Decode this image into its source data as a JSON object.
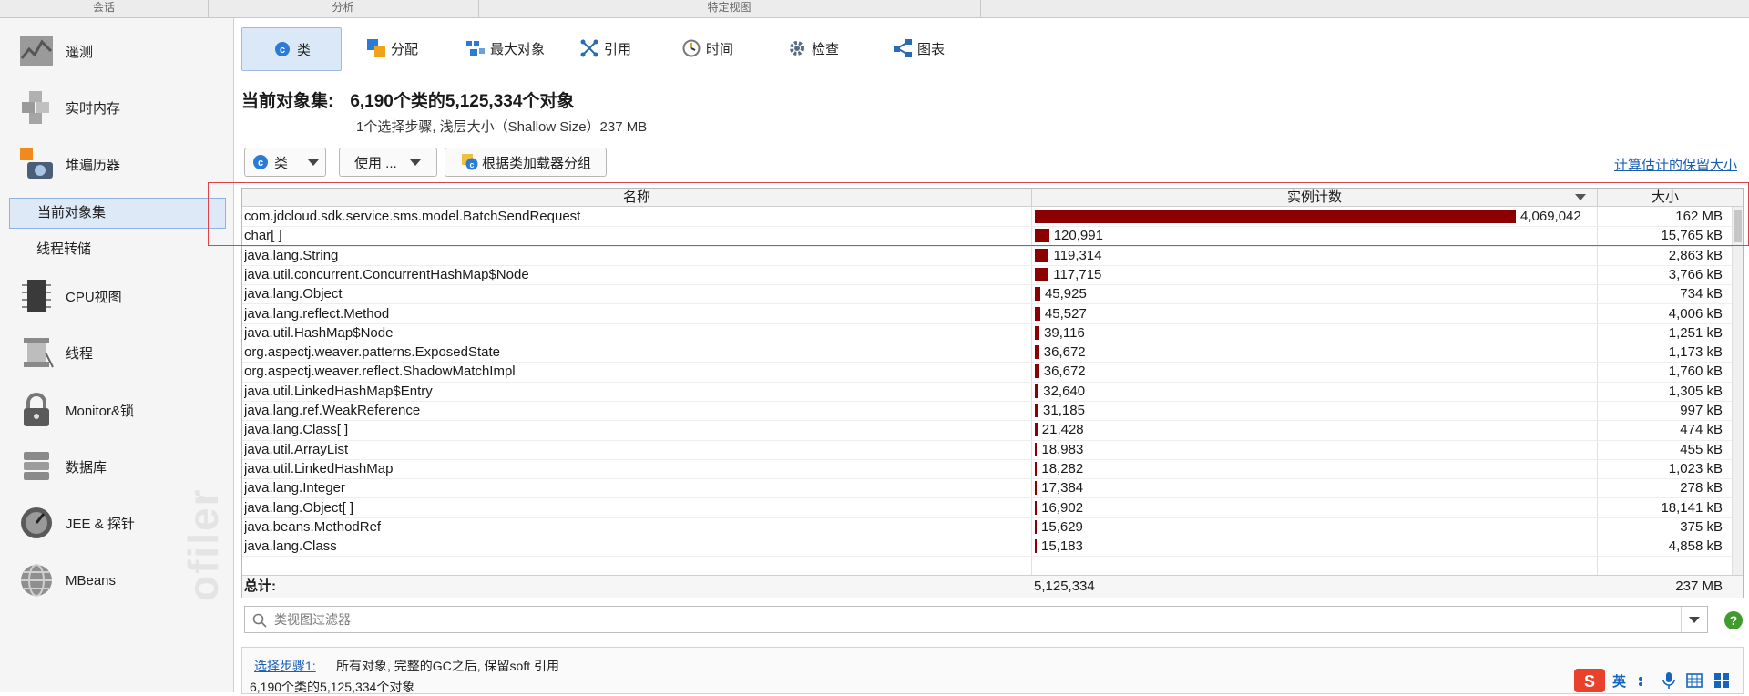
{
  "top_sections": [
    "会话",
    "分析",
    "特定视图"
  ],
  "sidebar": {
    "items": [
      {
        "label": "遥测",
        "icon": "telemetry-icon"
      },
      {
        "label": "实时内存",
        "icon": "live-memory-icon"
      },
      {
        "label": "堆遍历器",
        "icon": "heap-walker-icon"
      },
      {
        "label": "CPU视图",
        "icon": "cpu-icon"
      },
      {
        "label": "线程",
        "icon": "threads-icon"
      },
      {
        "label": "Monitor&锁",
        "icon": "lock-icon"
      },
      {
        "label": "数据库",
        "icon": "database-icon"
      },
      {
        "label": "JEE & 探针",
        "icon": "probe-icon"
      },
      {
        "label": "MBeans",
        "icon": "mbeans-icon"
      }
    ],
    "sub_items": [
      "当前对象集",
      "线程转储"
    ],
    "watermark": "ofiler"
  },
  "tabs": [
    {
      "label": "类",
      "icon": "class-icon"
    },
    {
      "label": "分配",
      "icon": "allocation-icon"
    },
    {
      "label": "最大对象",
      "icon": "biggest-objects-icon"
    },
    {
      "label": "引用",
      "icon": "references-icon"
    },
    {
      "label": "时间",
      "icon": "time-icon"
    },
    {
      "label": "检查",
      "icon": "inspection-icon"
    },
    {
      "label": "图表",
      "icon": "graph-icon"
    }
  ],
  "header": {
    "title_label": "当前对象集:",
    "title_value": "6,190个类的5,125,334个对象",
    "subtitle": "1个选择步骤, 浅层大小（Shallow Size）237 MB"
  },
  "toolbar": {
    "class_dropdown": "类",
    "use_dropdown": "使用 ...",
    "group_button": "根据类加载器分组",
    "calc_link": "计算估计的保留大小"
  },
  "table": {
    "columns": [
      "名称",
      "实例计数",
      "大小"
    ],
    "max_count": 4069042,
    "rows": [
      {
        "name": "com.jdcloud.sdk.service.sms.model.BatchSendRequest",
        "count": "4,069,042",
        "count_value": 4069042,
        "size": "162 MB"
      },
      {
        "name": "char[ ]",
        "count": "120,991",
        "count_value": 120991,
        "size": "15,765 kB"
      },
      {
        "name": "java.lang.String",
        "count": "119,314",
        "count_value": 119314,
        "size": "2,863 kB"
      },
      {
        "name": "java.util.concurrent.ConcurrentHashMap$Node",
        "count": "117,715",
        "count_value": 117715,
        "size": "3,766 kB"
      },
      {
        "name": "java.lang.Object",
        "count": "45,925",
        "count_value": 45925,
        "size": "734 kB"
      },
      {
        "name": "java.lang.reflect.Method",
        "count": "45,527",
        "count_value": 45527,
        "size": "4,006 kB"
      },
      {
        "name": "java.util.HashMap$Node",
        "count": "39,116",
        "count_value": 39116,
        "size": "1,251 kB"
      },
      {
        "name": "org.aspectj.weaver.patterns.ExposedState",
        "count": "36,672",
        "count_value": 36672,
        "size": "1,173 kB"
      },
      {
        "name": "org.aspectj.weaver.reflect.ShadowMatchImpl",
        "count": "36,672",
        "count_value": 36672,
        "size": "1,760 kB"
      },
      {
        "name": "java.util.LinkedHashMap$Entry",
        "count": "32,640",
        "count_value": 32640,
        "size": "1,305 kB"
      },
      {
        "name": "java.lang.ref.WeakReference",
        "count": "31,185",
        "count_value": 31185,
        "size": "997 kB"
      },
      {
        "name": "java.lang.Class[ ]",
        "count": "21,428",
        "count_value": 21428,
        "size": "474 kB"
      },
      {
        "name": "java.util.ArrayList",
        "count": "18,983",
        "count_value": 18983,
        "size": "455 kB"
      },
      {
        "name": "java.util.LinkedHashMap",
        "count": "18,282",
        "count_value": 18282,
        "size": "1,023 kB"
      },
      {
        "name": "java.lang.Integer",
        "count": "17,384",
        "count_value": 17384,
        "size": "278 kB"
      },
      {
        "name": "java.lang.Object[ ]",
        "count": "16,902",
        "count_value": 16902,
        "size": "18,141 kB"
      },
      {
        "name": "java.beans.MethodRef",
        "count": "15,629",
        "count_value": 15629,
        "size": "375 kB"
      },
      {
        "name": "java.lang.Class",
        "count": "15,183",
        "count_value": 15183,
        "size": "4,858 kB"
      }
    ],
    "total": {
      "label": "总计:",
      "count": "5,125,334",
      "size": "237 MB"
    }
  },
  "filter": {
    "placeholder": "类视图过滤器"
  },
  "bottom": {
    "step_link": "选择步骤1:",
    "step_text": "所有对象, 完整的GC之后, 保留soft 引用",
    "summary": "6,190个类的5,125,334个对象"
  },
  "ime": [
    "英"
  ],
  "colors": {
    "bar": "#8b0000",
    "highlight": "#e0414a",
    "accent": "#1a5fb4"
  }
}
